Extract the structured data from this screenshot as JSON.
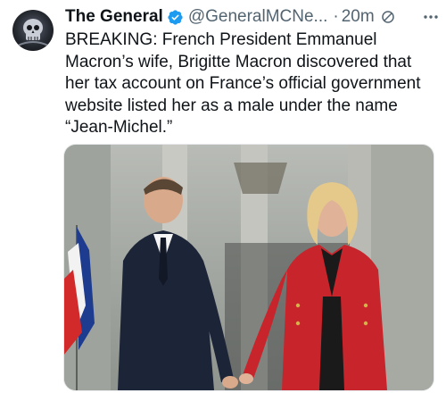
{
  "tweet": {
    "display_name": "The General",
    "handle": "@GeneralMCNe...",
    "separator": "·",
    "time": "20m",
    "text_lines": [
      "BREAKING: French President Emmanuel",
      "Macron’s wife, Brigitte Macron discovered that",
      "her tax account on France’s official government",
      "website listed her as a male under the name",
      "“Jean-Michel.”"
    ]
  },
  "icons": {
    "verified": "verified-badge-icon",
    "mute": "no-entry-icon",
    "more": "more-options-icon"
  },
  "colors": {
    "verified_blue": "#1d9bf0",
    "secondary_text": "#536471",
    "primary_text": "#0f1419"
  }
}
